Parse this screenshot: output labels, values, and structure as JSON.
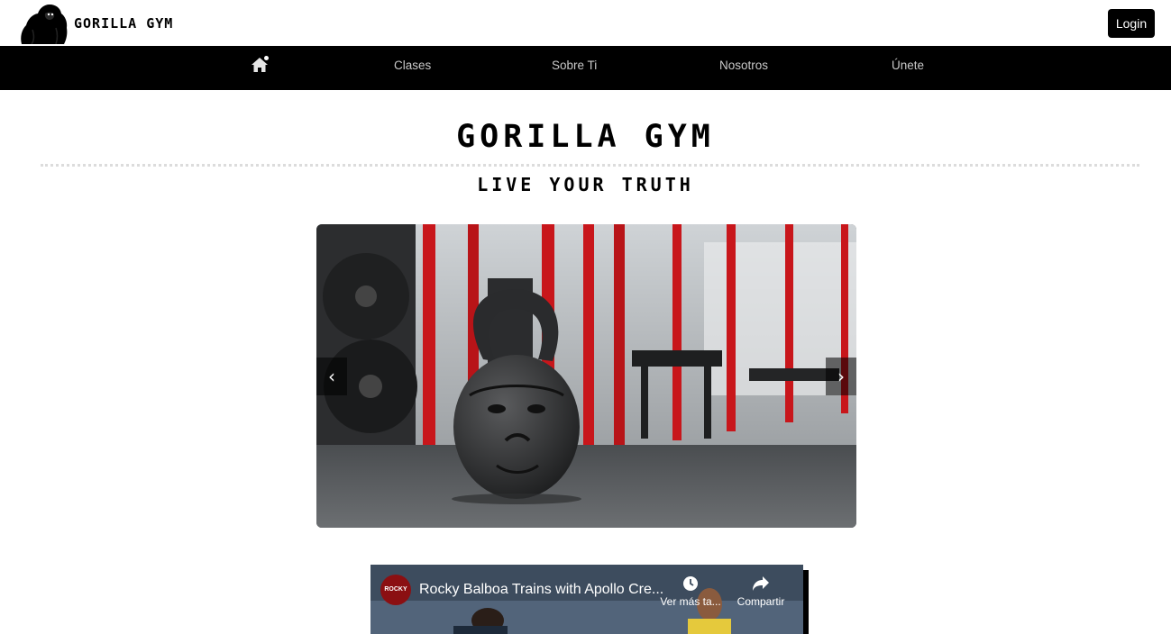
{
  "header": {
    "brand_name": "GORILLA GYM",
    "login_label": "Login"
  },
  "nav": {
    "home_icon": "home-icon",
    "items": [
      {
        "label": "Clases"
      },
      {
        "label": "Sobre Ti"
      },
      {
        "label": "Nosotros"
      },
      {
        "label": "Únete"
      }
    ]
  },
  "hero": {
    "title": "GORILLA GYM",
    "subtitle": "LIVE YOUR TRUTH"
  },
  "carousel": {
    "prev_label": "‹",
    "next_label": "›"
  },
  "video": {
    "channel_label": "ROCKY",
    "title": "Rocky Balboa Trains with Apollo Cre...",
    "watch_later_label": "Ver más ta...",
    "share_label": "Compartir"
  },
  "colors": {
    "nav_bg": "#000000",
    "nav_text": "#c9c9c9",
    "button_bg": "#000000",
    "accent_red": "#c8161b"
  }
}
